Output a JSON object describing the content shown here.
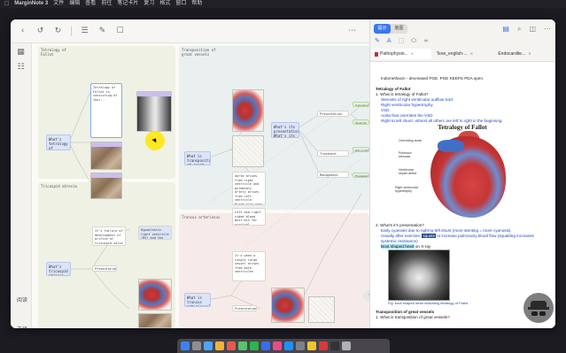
{
  "menubar": {
    "app_name": "MarginNote 3",
    "items": [
      "文件",
      "编辑",
      "查看",
      "前往",
      "笔记卡片",
      "复习",
      "格式",
      "窗口",
      "帮助"
    ]
  },
  "toolbar": {
    "icons": [
      "back-icon",
      "undo-icon",
      "redo-icon",
      "list-icon",
      "edit-icon",
      "bookmark-icon",
      "more-icon"
    ]
  },
  "leftrail": {
    "labels": [
      "阅读",
      "选择"
    ]
  },
  "canvas": {
    "sections": [
      {
        "title": "Tetralogy of Fallot"
      },
      {
        "title": "Transposition of great vessels"
      },
      {
        "title": "Truncus arteriosus"
      },
      {
        "title": "Tricuspid atresia"
      }
    ],
    "cards": {
      "tof_q": "What's tetralogy of Fallot? What are its signs?",
      "tof_text": "Tetralogy of Fallot is consisting of four...",
      "tga_q": "What is transposition of great vessels?",
      "tga_text": "Aorta arises from right ventricle and pulmonary artery arises from left ventricle. Blood flow goes parallel rather than in series",
      "tga_text2": "Left and right sided blood must mix for survival",
      "tga_presentation": "What's its presentation? What's its treatment? What's its x-ray?",
      "tricuspid_q": "What's tricuspid atresia and what does it need?",
      "tricuspid_text": "It's failure of development of orifice of tricuspid valve",
      "tricuspid_presentation": "Presentation",
      "truncus_q": "What is truncus arteriosus?",
      "truncus_text": "It's when a single large vessel arises from both ventricles",
      "truncus_presentation": "Presentation:",
      "mitral": "Hypoplastic right ventricle (RV) and the large mitral",
      "tof_nodes": [
        "Presentation",
        "Treatment",
        "Management"
      ],
      "green_nodes": [
        "Cyanosis at birth",
        "Single S2",
        "Egg on string",
        "Prostaglandin E1",
        "Arterial switch",
        "Balloon septostomy"
      ]
    },
    "nav_btn": "< >"
  },
  "panel": {
    "segments": [
      "提示",
      "脑图"
    ],
    "tabs": [
      "Pathophysio...",
      "Tese_english-...",
      "Endocardite..."
    ],
    "doc": {
      "line0": "Indomethacin - decreased PGE. PGE KEEPS PDA open.",
      "heading1": "Tetralogy of Fallot",
      "item1": "1.  What is tetralogy of Fallot?",
      "sub1": "Stenosis of right ventricular outflow tract",
      "sub2": "Right ventricular hypertrophy",
      "sub3": "VSD",
      "sub4": "Aorta that overrides the VSD",
      "sub5": "Right to left shunt. Almost all others are left to right in the beginning.",
      "fig_title": "Tetralogy of Fallot",
      "lbl_overriding": "Overriding aorta",
      "lbl_pulmonic": "Pulmonic stenosis",
      "lbl_vsd": "Ventricular septal defect",
      "lbl_rvh": "Right ventricular hypertrophy",
      "item2": "2.  What's it's presentation?",
      "p1": "Early cyanosis due to right-to-left shunt (more stenting = more cyanosis).",
      "p2_a": "Usually after exercise, ",
      "p2_hl": "squats",
      "p2_b": " to increase pulmonary blood flow (squatting increases systemic resistance)",
      "p3_hl": "Boot shaped heart",
      "p3_b": " on X-ray",
      "caption": "Fig: boot shaped heart indicating tetralogy of Fallot",
      "heading2": "Transposition of great vessels",
      "item3": "1.  What is transposition of great vessels?"
    }
  },
  "colors": {
    "accent": "#3978f0",
    "section_tof": "#eef1e4",
    "section_tga": "#eaeff0",
    "section_tricuspid": "#eef1e4",
    "section_truncus": "#f6ebe8"
  }
}
